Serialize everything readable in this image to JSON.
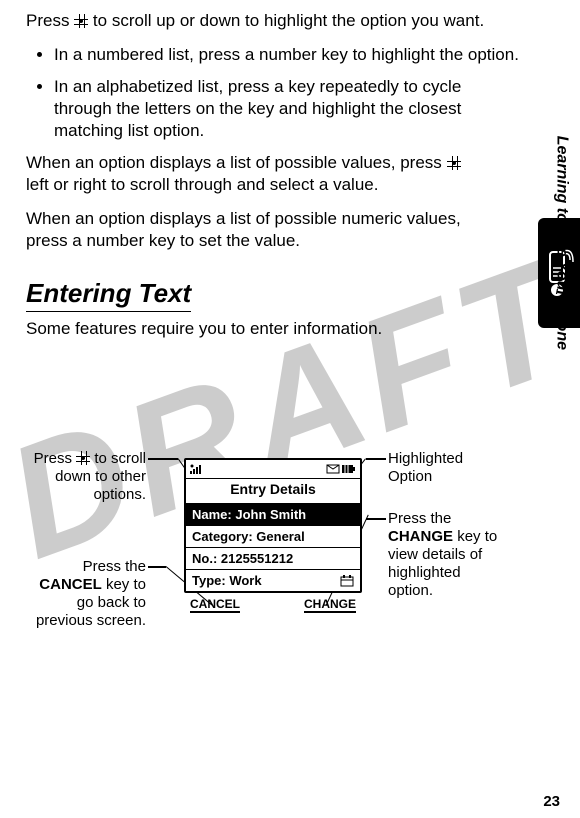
{
  "watermark": "DRAFT",
  "intro": {
    "l1a": "Press ",
    "l1b": " to scroll up or down to highlight the option you want."
  },
  "bullets": [
    "In a numbered list, press a number key to highlight the option.",
    "In an alphabetized list, press a key repeatedly to cycle through the letters on the key and highlight the closest matching list option."
  ],
  "para2a": "When an option displays a list of possible values, press ",
  "para2b": " left or right to scroll through and select a value.",
  "para3": "When an option displays a list of possible numeric values, press a number key to set the value.",
  "heading": "Entering Text",
  "subtext": "Some features require you to enter information.",
  "side_label": "Learning to Use Your Phone",
  "callouts": {
    "top_left_a": "Press ",
    "top_left_b": " to scroll down to other options.",
    "bottom_left_a": "Press the ",
    "bottom_left_key": "CANCEL",
    "bottom_left_b": " key to go back to previous screen.",
    "top_right": "Highlighted Option",
    "bottom_right_a": "Press the ",
    "bottom_right_key": "CHANGE",
    "bottom_right_b": " key to view details of highlighted option."
  },
  "screen": {
    "title": "Entry Details",
    "row1": "Name: John Smith",
    "row2": "Category: General",
    "row3": "No.: 2125551212",
    "row4": "Type: Work",
    "soft_left": "CANCEL",
    "soft_right": "CHANGE"
  },
  "page_number": "23"
}
